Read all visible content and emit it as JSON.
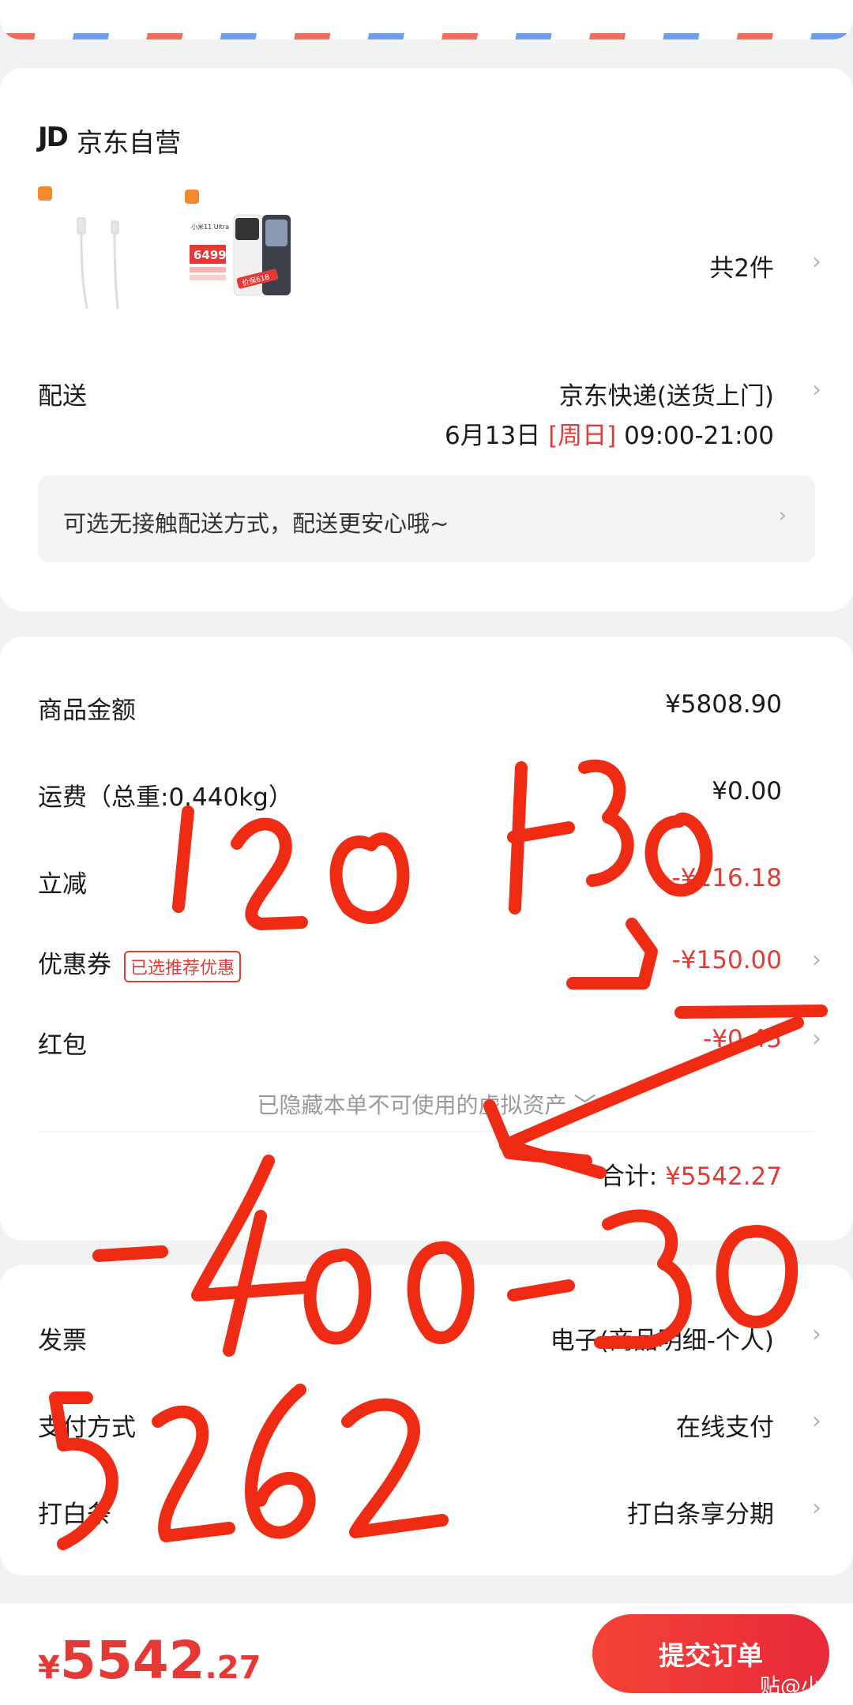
{
  "shop": {
    "logo": "JD",
    "name": "京东自营"
  },
  "products": {
    "thumbs": [
      {
        "name": "usb-cable"
      },
      {
        "name": "xiaomi-11-ultra",
        "model_text": "小米11 Ultra",
        "price_tag": "6499",
        "promo": "价保618"
      }
    ],
    "count_label": "共2件"
  },
  "delivery": {
    "label": "配送",
    "method": "京东快递(送货上门)",
    "date": "6月13日",
    "weekday": "[周日]",
    "time": "09:00-21:00",
    "notice": "可选无接触配送方式，配送更安心哦~"
  },
  "summary": {
    "rows": [
      {
        "label": "商品金额",
        "value": "¥5808.90"
      },
      {
        "label": "运费（总重:0.440kg）",
        "value": "¥0.00"
      },
      {
        "label": "立减",
        "value": "-¥116.18"
      },
      {
        "label": "优惠券",
        "badge": "已选推荐优惠",
        "value": "-¥150.00"
      },
      {
        "label": "红包",
        "value": "-¥0.45"
      }
    ],
    "hidden_note": "已隐藏本单不可使用的虚拟资产",
    "total_label": "合计:",
    "total_value": "¥5542.27"
  },
  "extras": [
    {
      "label": "发票",
      "value": "电子(商品明细-个人)"
    },
    {
      "label": "支付方式",
      "value": "在线支付"
    },
    {
      "label": "打白条",
      "value": "打白条享分期"
    }
  ],
  "bottom": {
    "currency": "¥",
    "price_int": "5542",
    "price_dec": ".27",
    "submit": "提交订单"
  },
  "watermark": "贴@小米",
  "colors": {
    "accent": "#e53935",
    "scribble": "#ef2b14"
  }
}
